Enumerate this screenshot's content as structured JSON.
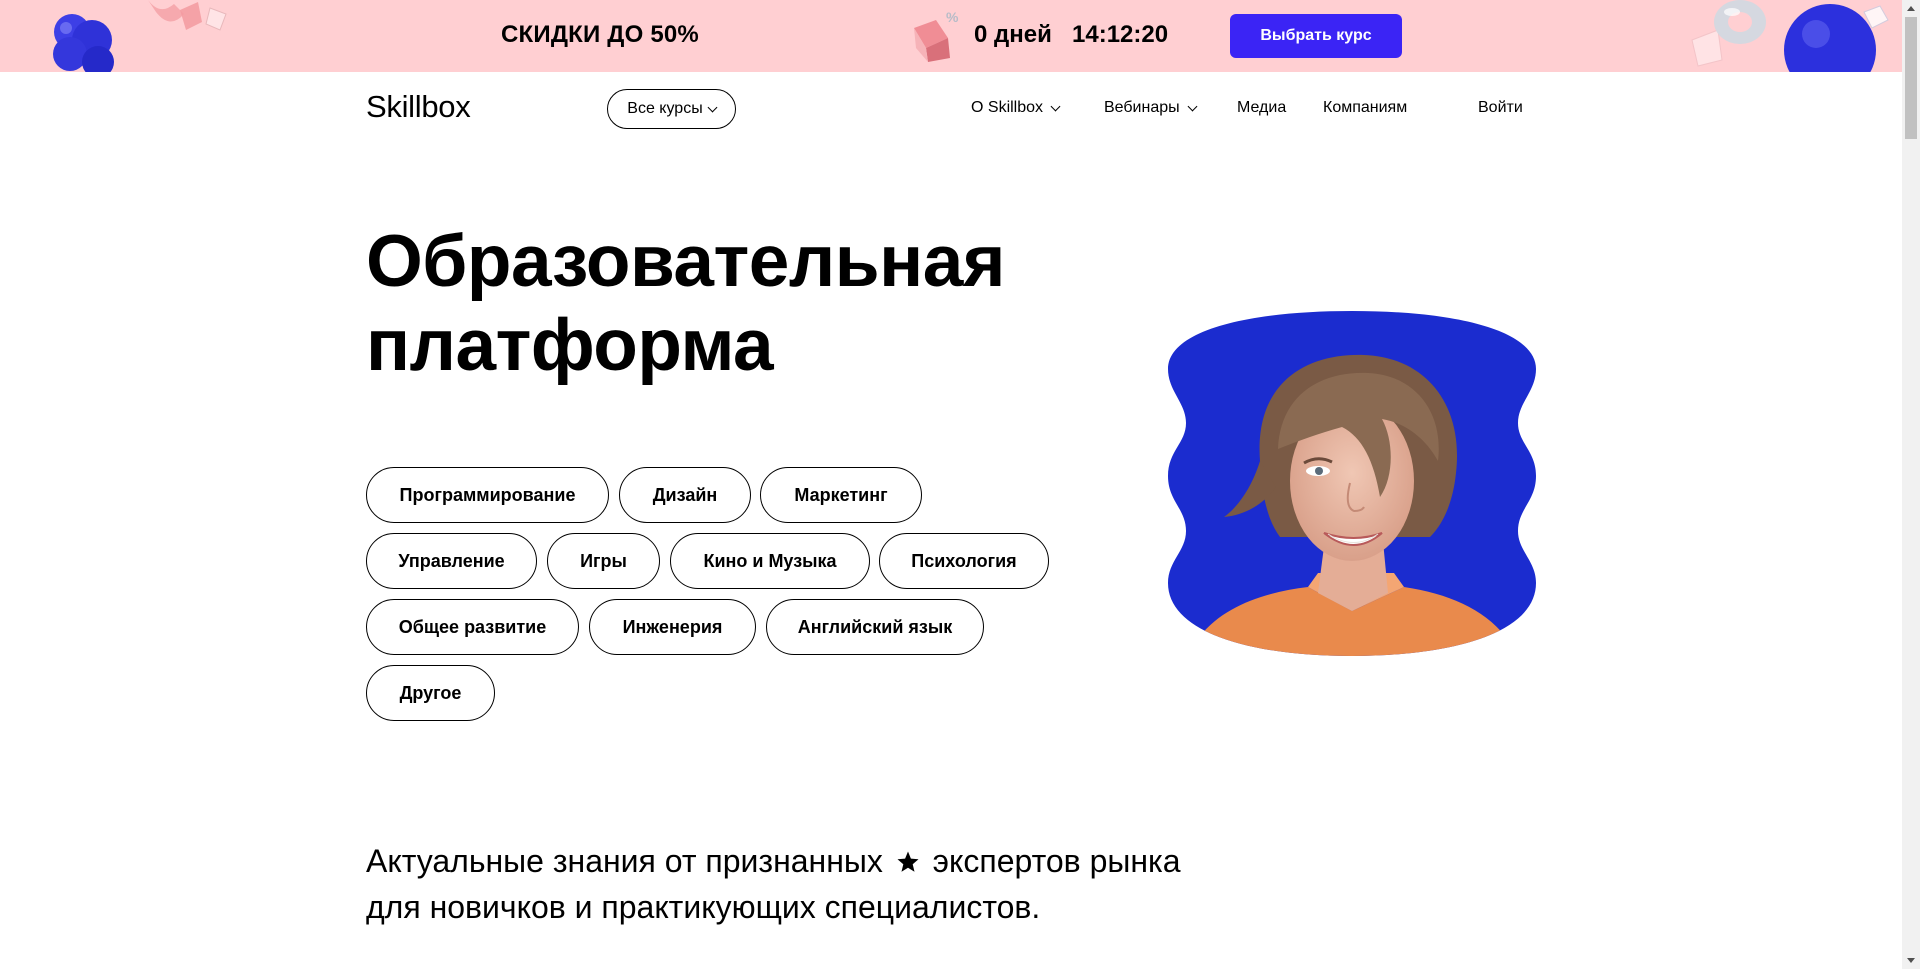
{
  "banner": {
    "promo": "СКИДКИ ДО 50%",
    "countdown_days": "0 дней",
    "countdown_time": "14:12:20",
    "cta_label": "Выбрать курс",
    "bg_color": "#ffcfd2",
    "cta_color": "#3b24f5"
  },
  "header": {
    "logo": "Skillbox",
    "all_courses": "Все курсы",
    "nav": {
      "about": "О Skillbox",
      "webinars": "Вебинары",
      "media": "Медиа",
      "companies": "Компаниям",
      "login": "Войти"
    }
  },
  "hero": {
    "title_line1": "Образовательная",
    "title_line2": "платформа",
    "categories": [
      "Программирование",
      "Дизайн",
      "Маркетинг",
      "Управление",
      "Игры",
      "Кино и Музыка",
      "Психология",
      "Общее развитие",
      "Инженерия",
      "Английский язык",
      "Другое"
    ],
    "image_bg_color": "#1b2ccf"
  },
  "subtitle": {
    "line1_before": "Актуальные знания от признанных",
    "line1_after": "экспертов рынка",
    "line2": "для новичков и практикующих специалистов."
  }
}
